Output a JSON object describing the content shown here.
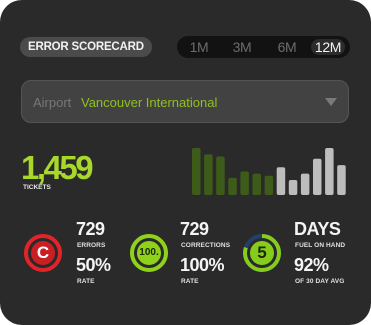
{
  "header": {
    "title": "ERROR SCORECARD",
    "ranges": [
      "1M",
      "3M",
      "6M",
      "12M"
    ],
    "active_range": "12M"
  },
  "filter": {
    "label": "Airport",
    "value": "Vancouver International"
  },
  "summary": {
    "total": "1,459",
    "caption": "TICKETS"
  },
  "bar_chart": {
    "green_values": [
      44,
      38,
      36,
      16,
      22,
      20,
      18
    ],
    "gray_values": [
      26,
      14,
      20,
      34,
      44,
      28
    ],
    "green_color": "#3d5c1a",
    "gray_color": "#bdbdbd"
  },
  "stats": [
    {
      "icon": "c-icon",
      "icon_text": "C",
      "ring_color": "#e0252a",
      "ring_fraction": 1.0,
      "count": "729",
      "count_label": "ERRORS",
      "percent": "50%",
      "percent_label": "RATE"
    },
    {
      "icon": "100-icon",
      "icon_text": "100.",
      "ring_color": "#8fd11b",
      "ring_fraction": 1.0,
      "count": "729",
      "count_label": "CORRECTIONS",
      "percent": "100%",
      "percent_label": "RATE"
    },
    {
      "icon": "5-icon",
      "icon_text": "5",
      "ring_color": "#86cc1d",
      "ring_fraction": 0.8,
      "count": "DAYS",
      "count_label": "FUEL ON HAND",
      "percent": "92%",
      "percent_label": "OF 30 DAY AVG"
    }
  ]
}
